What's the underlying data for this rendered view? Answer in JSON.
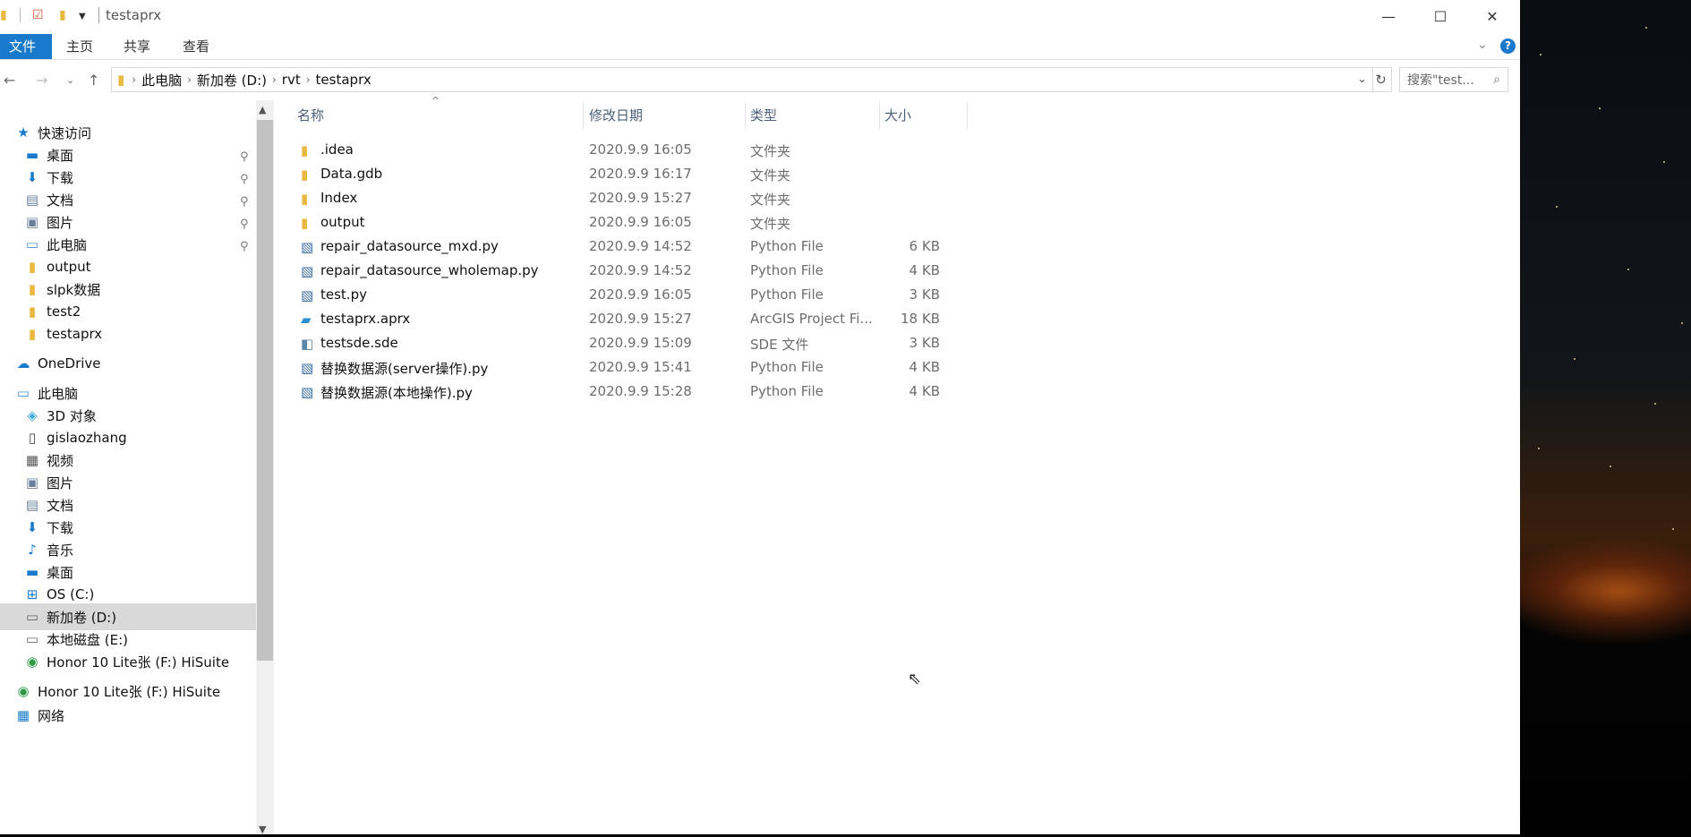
{
  "window": {
    "title": "testaprx",
    "quick_access_icons": [
      "folder-icon",
      "properties-icon",
      "new-folder-icon",
      "dropdown-icon"
    ]
  },
  "ribbon": {
    "tabs": [
      "文件",
      "主页",
      "共享",
      "查看"
    ]
  },
  "address": {
    "breadcrumbs": [
      "此电脑",
      "新加卷 (D:)",
      "rvt",
      "testaprx"
    ],
    "search_placeholder": "搜索\"test..."
  },
  "nav_pane": {
    "quick_access_label": "快速访问",
    "quick_access_items": [
      {
        "label": "桌面",
        "icon": "desktop-icon",
        "pinned": true
      },
      {
        "label": "下载",
        "icon": "download-icon",
        "pinned": true
      },
      {
        "label": "文档",
        "icon": "document-icon",
        "pinned": true
      },
      {
        "label": "图片",
        "icon": "picture-icon",
        "pinned": true
      },
      {
        "label": "此电脑",
        "icon": "computer-icon",
        "pinned": true
      },
      {
        "label": "output",
        "icon": "folder-icon",
        "pinned": false
      },
      {
        "label": "slpk数据",
        "icon": "folder-icon",
        "pinned": false
      },
      {
        "label": "test2",
        "icon": "folder-icon",
        "pinned": false
      },
      {
        "label": "testaprx",
        "icon": "folder-icon",
        "pinned": false
      }
    ],
    "onedrive_label": "OneDrive",
    "this_pc_label": "此电脑",
    "this_pc_items": [
      {
        "label": "3D 对象",
        "icon": "3d-objects-icon"
      },
      {
        "label": "gislaozhang",
        "icon": "phone-icon"
      },
      {
        "label": "视频",
        "icon": "video-icon"
      },
      {
        "label": "图片",
        "icon": "picture-icon"
      },
      {
        "label": "文档",
        "icon": "document-icon"
      },
      {
        "label": "下载",
        "icon": "download-icon"
      },
      {
        "label": "音乐",
        "icon": "music-icon"
      },
      {
        "label": "桌面",
        "icon": "desktop-icon"
      },
      {
        "label": "OS (C:)",
        "icon": "windows-drive-icon"
      },
      {
        "label": "新加卷 (D:)",
        "icon": "drive-icon",
        "selected": true
      },
      {
        "label": "本地磁盘 (E:)",
        "icon": "drive-icon"
      },
      {
        "label": "Honor 10 Lite张 (F:) HiSuite",
        "icon": "hisuite-icon"
      }
    ],
    "bottom_items": [
      {
        "label": "Honor 10 Lite张 (F:) HiSuite",
        "icon": "hisuite-icon"
      },
      {
        "label": "网络",
        "icon": "network-icon"
      }
    ]
  },
  "file_list": {
    "columns": [
      "名称",
      "修改日期",
      "类型",
      "大小"
    ],
    "files": [
      {
        "name": ".idea",
        "date": "2020.9.9 16:05",
        "type": "文件夹",
        "size": "",
        "icon": "folder-icon"
      },
      {
        "name": "Data.gdb",
        "date": "2020.9.9 16:17",
        "type": "文件夹",
        "size": "",
        "icon": "folder-icon"
      },
      {
        "name": "Index",
        "date": "2020.9.9 15:27",
        "type": "文件夹",
        "size": "",
        "icon": "folder-icon"
      },
      {
        "name": "output",
        "date": "2020.9.9 16:05",
        "type": "文件夹",
        "size": "",
        "icon": "folder-icon"
      },
      {
        "name": "repair_datasource_mxd.py",
        "date": "2020.9.9 14:52",
        "type": "Python File",
        "size": "6 KB",
        "icon": "python-file-icon"
      },
      {
        "name": "repair_datasource_wholemap.py",
        "date": "2020.9.9 14:52",
        "type": "Python File",
        "size": "4 KB",
        "icon": "python-file-icon"
      },
      {
        "name": "test.py",
        "date": "2020.9.9 16:05",
        "type": "Python File",
        "size": "3 KB",
        "icon": "python-file-icon"
      },
      {
        "name": "testaprx.aprx",
        "date": "2020.9.9 15:27",
        "type": "ArcGIS Project Fi...",
        "size": "18 KB",
        "icon": "arcgis-project-icon"
      },
      {
        "name": "testsde.sde",
        "date": "2020.9.9 15:09",
        "type": "SDE 文件",
        "size": "3 KB",
        "icon": "sde-file-icon"
      },
      {
        "name": "替换数据源(server操作).py",
        "date": "2020.9.9 15:41",
        "type": "Python File",
        "size": "4 KB",
        "icon": "python-file-icon"
      },
      {
        "name": "替换数据源(本地操作).py",
        "date": "2020.9.9 15:28",
        "type": "Python File",
        "size": "4 KB",
        "icon": "python-file-icon"
      }
    ]
  }
}
